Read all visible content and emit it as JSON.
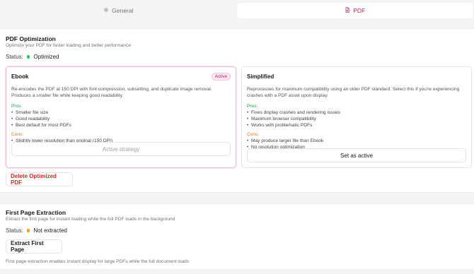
{
  "tabs": [
    {
      "label": "General",
      "icon": "gear-icon",
      "active": false
    },
    {
      "label": "PDF",
      "icon": "file-icon",
      "active": true
    }
  ],
  "optimization": {
    "title": "PDF Optimization",
    "subtitle": "Optimize your PDF for faster loading and better performance",
    "status_label": "Status:",
    "status_value": "Optimized",
    "status_color": "#22c55e",
    "delete_label": "Delete Optimized PDF",
    "strategies": [
      {
        "title": "Ebook",
        "badge": "Active",
        "description": "Re-encodes the PDF at 150 DPI with font compression, subsetting, and duplicate image removal. Produces a smaller file while keeping good readability.",
        "pros_label": "Pros:",
        "pros": [
          "Smaller file size",
          "Good readability",
          "Best default for most PDFs"
        ],
        "cons_label": "Cons:",
        "cons": [
          "Slightly lower resolution than original (150 DPI)"
        ],
        "button": "Active strategy"
      },
      {
        "title": "Simplified",
        "description": "Reprocesses for maximum compatibility using an older PDF standard. Select this if you're experiencing crashes with a PDF asset upon display.",
        "pros_label": "Pros:",
        "pros": [
          "Fixes display crashes and rendering issues",
          "Maximum browser compatibility",
          "Works with problematic PDFs"
        ],
        "cons_label": "Cons:",
        "cons": [
          "May produce larger file than Ebook",
          "No resolution optimization"
        ],
        "button": "Set as active"
      }
    ]
  },
  "extraction": {
    "title": "First Page Extraction",
    "subtitle": "Extract the first page for instant loading while the full PDF loads in the background",
    "status_label": "Status:",
    "status_value": "Not extracted",
    "status_color": "#f59e0b",
    "button": "Extract First Page",
    "note": "First page extraction enables instant display for large PDFs while the full document loads"
  },
  "colors": {
    "accent": "#be185d",
    "pros": "#16a34a",
    "cons": "#d97706",
    "danger": "#dc2626"
  }
}
